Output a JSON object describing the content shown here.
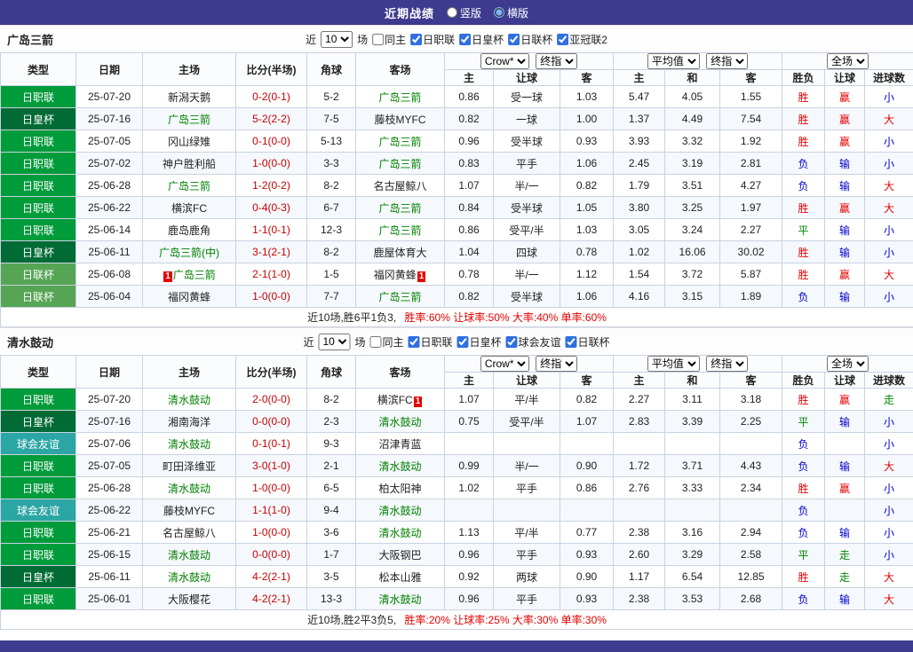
{
  "top_bar": {
    "title": "近期战绩",
    "radios": [
      {
        "label": "竖版",
        "selected": false
      },
      {
        "label": "横版",
        "selected": true
      }
    ]
  },
  "filter_labels": {
    "near": "近",
    "matches": "场"
  },
  "table_columns": {
    "type": "类型",
    "date": "日期",
    "home": "主场",
    "score": "比分(半场)",
    "corner": "角球",
    "away": "客场",
    "odds_home": "主",
    "odds_handicap": "让球",
    "odds_away": "客",
    "avg_home": "主",
    "avg_draw": "和",
    "avg_away": "客",
    "result": "胜负",
    "handicap_result": "让球",
    "goals": "进球数"
  },
  "odds_selects": {
    "bookmaker": "Crow*",
    "final_index": "终指",
    "average": "平均值",
    "full_time": "全场"
  },
  "colors": {
    "top_bar": "#3D3A8F",
    "score": "#C80000",
    "tracked_team": "#008000",
    "win": "#E60000",
    "lose": "#0000CC",
    "draw": "#008800",
    "summary_stats": "#E60000"
  },
  "sections": [
    {
      "team": "广岛三箭",
      "filter": {
        "count": "10",
        "same": {
          "label": "同主",
          "checked": false
        },
        "leagues": [
          {
            "label": "日职联",
            "checked": true
          },
          {
            "label": "日皇杯",
            "checked": true
          },
          {
            "label": "日联杯",
            "checked": true
          },
          {
            "label": "亚冠联2",
            "checked": true
          }
        ]
      },
      "rows": [
        {
          "league": "日职联",
          "league_color": "#009B3A",
          "date": "25-07-20",
          "home": "新潟天鹅",
          "home_tracked": false,
          "home_badge": "",
          "score": "0-2(0-1)",
          "corner": "5-2",
          "away": "广岛三箭",
          "away_tracked": true,
          "away_badge": "",
          "odds": [
            "0.86",
            "受一球",
            "1.03",
            "5.47",
            "4.05",
            "1.55"
          ],
          "results": [
            {
              "text": "胜",
              "kind": "win"
            },
            {
              "text": "赢",
              "kind": "win"
            },
            {
              "text": "小",
              "kind": "lose"
            }
          ]
        },
        {
          "league": "日皇杯",
          "league_color": "#006B35",
          "date": "25-07-16",
          "home": "广岛三箭",
          "home_tracked": true,
          "home_badge": "",
          "score": "5-2(2-2)",
          "corner": "7-5",
          "away": "藤枝MYFC",
          "away_tracked": false,
          "away_badge": "",
          "odds": [
            "0.82",
            "一球",
            "1.00",
            "1.37",
            "4.49",
            "7.54"
          ],
          "results": [
            {
              "text": "胜",
              "kind": "win"
            },
            {
              "text": "赢",
              "kind": "win"
            },
            {
              "text": "大",
              "kind": "win"
            }
          ]
        },
        {
          "league": "日职联",
          "league_color": "#009B3A",
          "date": "25-07-05",
          "home": "冈山绿雉",
          "home_tracked": false,
          "home_badge": "",
          "score": "0-1(0-0)",
          "corner": "5-13",
          "away": "广岛三箭",
          "away_tracked": true,
          "away_badge": "",
          "odds": [
            "0.96",
            "受半球",
            "0.93",
            "3.93",
            "3.32",
            "1.92"
          ],
          "results": [
            {
              "text": "胜",
              "kind": "win"
            },
            {
              "text": "赢",
              "kind": "win"
            },
            {
              "text": "小",
              "kind": "lose"
            }
          ]
        },
        {
          "league": "日职联",
          "league_color": "#009B3A",
          "date": "25-07-02",
          "home": "神户胜利船",
          "home_tracked": false,
          "home_badge": "",
          "score": "1-0(0-0)",
          "corner": "3-3",
          "away": "广岛三箭",
          "away_tracked": true,
          "away_badge": "",
          "odds": [
            "0.83",
            "平手",
            "1.06",
            "2.45",
            "3.19",
            "2.81"
          ],
          "results": [
            {
              "text": "负",
              "kind": "lose"
            },
            {
              "text": "输",
              "kind": "lose"
            },
            {
              "text": "小",
              "kind": "lose"
            }
          ]
        },
        {
          "league": "日职联",
          "league_color": "#009B3A",
          "date": "25-06-28",
          "home": "广岛三箭",
          "home_tracked": true,
          "home_badge": "",
          "score": "1-2(0-2)",
          "corner": "8-2",
          "away": "名古屋鲸八",
          "away_tracked": false,
          "away_badge": "",
          "odds": [
            "1.07",
            "半/一",
            "0.82",
            "1.79",
            "3.51",
            "4.27"
          ],
          "results": [
            {
              "text": "负",
              "kind": "lose"
            },
            {
              "text": "输",
              "kind": "lose"
            },
            {
              "text": "大",
              "kind": "win"
            }
          ]
        },
        {
          "league": "日职联",
          "league_color": "#009B3A",
          "date": "25-06-22",
          "home": "横滨FC",
          "home_tracked": false,
          "home_badge": "",
          "score": "0-4(0-3)",
          "corner": "6-7",
          "away": "广岛三箭",
          "away_tracked": true,
          "away_badge": "",
          "odds": [
            "0.84",
            "受半球",
            "1.05",
            "3.80",
            "3.25",
            "1.97"
          ],
          "results": [
            {
              "text": "胜",
              "kind": "win"
            },
            {
              "text": "赢",
              "kind": "win"
            },
            {
              "text": "大",
              "kind": "win"
            }
          ]
        },
        {
          "league": "日职联",
          "league_color": "#009B3A",
          "date": "25-06-14",
          "home": "鹿岛鹿角",
          "home_tracked": false,
          "home_badge": "",
          "score": "1-1(0-1)",
          "corner": "12-3",
          "away": "广岛三箭",
          "away_tracked": true,
          "away_badge": "",
          "odds": [
            "0.86",
            "受平/半",
            "1.03",
            "3.05",
            "3.24",
            "2.27"
          ],
          "results": [
            {
              "text": "平",
              "kind": "draw"
            },
            {
              "text": "输",
              "kind": "lose"
            },
            {
              "text": "小",
              "kind": "lose"
            }
          ]
        },
        {
          "league": "日皇杯",
          "league_color": "#006B35",
          "date": "25-06-11",
          "home": "广岛三箭(中)",
          "home_tracked": true,
          "home_badge": "",
          "score": "3-1(2-1)",
          "corner": "8-2",
          "away": "鹿屋体育大",
          "away_tracked": false,
          "away_badge": "",
          "odds": [
            "1.04",
            "四球",
            "0.78",
            "1.02",
            "16.06",
            "30.02"
          ],
          "results": [
            {
              "text": "胜",
              "kind": "win"
            },
            {
              "text": "输",
              "kind": "lose"
            },
            {
              "text": "小",
              "kind": "lose"
            }
          ]
        },
        {
          "league": "日联杯",
          "league_color": "#55A555",
          "date": "25-06-08",
          "home": "广岛三箭",
          "home_tracked": true,
          "home_badge": "1",
          "score": "2-1(1-0)",
          "corner": "1-5",
          "away": "福冈黄蜂",
          "away_tracked": false,
          "away_badge": "1",
          "odds": [
            "0.78",
            "半/一",
            "1.12",
            "1.54",
            "3.72",
            "5.87"
          ],
          "results": [
            {
              "text": "胜",
              "kind": "win"
            },
            {
              "text": "赢",
              "kind": "win"
            },
            {
              "text": "大",
              "kind": "win"
            }
          ]
        },
        {
          "league": "日联杯",
          "league_color": "#55A555",
          "date": "25-06-04",
          "home": "福冈黄蜂",
          "home_tracked": false,
          "home_badge": "",
          "score": "1-0(0-0)",
          "corner": "7-7",
          "away": "广岛三箭",
          "away_tracked": true,
          "away_badge": "",
          "odds": [
            "0.82",
            "受半球",
            "1.06",
            "4.16",
            "3.15",
            "1.89"
          ],
          "results": [
            {
              "text": "负",
              "kind": "lose"
            },
            {
              "text": "输",
              "kind": "lose"
            },
            {
              "text": "小",
              "kind": "lose"
            }
          ]
        }
      ],
      "summary": {
        "record": "近10场,胜6平1负3,",
        "stats": "胜率:60% 让球率:50% 大率:40% 单率:60%"
      }
    },
    {
      "team": "清水鼓动",
      "filter": {
        "count": "10",
        "same": {
          "label": "同主",
          "checked": false
        },
        "leagues": [
          {
            "label": "日职联",
            "checked": true
          },
          {
            "label": "日皇杯",
            "checked": true
          },
          {
            "label": "球会友谊",
            "checked": true
          },
          {
            "label": "日联杯",
            "checked": true
          }
        ]
      },
      "rows": [
        {
          "league": "日职联",
          "league_color": "#009B3A",
          "date": "25-07-20",
          "home": "清水鼓动",
          "home_tracked": true,
          "home_badge": "",
          "score": "2-0(0-0)",
          "corner": "8-2",
          "away": "横滨FC",
          "away_tracked": false,
          "away_badge": "1",
          "odds": [
            "1.07",
            "平/半",
            "0.82",
            "2.27",
            "3.11",
            "3.18"
          ],
          "results": [
            {
              "text": "胜",
              "kind": "win"
            },
            {
              "text": "赢",
              "kind": "win"
            },
            {
              "text": "走",
              "kind": "draw"
            }
          ]
        },
        {
          "league": "日皇杯",
          "league_color": "#006B35",
          "date": "25-07-16",
          "home": "湘南海洋",
          "home_tracked": false,
          "home_badge": "",
          "score": "0-0(0-0)",
          "corner": "2-3",
          "away": "清水鼓动",
          "away_tracked": true,
          "away_badge": "",
          "odds": [
            "0.75",
            "受平/半",
            "1.07",
            "2.83",
            "3.39",
            "2.25"
          ],
          "results": [
            {
              "text": "平",
              "kind": "draw"
            },
            {
              "text": "输",
              "kind": "lose"
            },
            {
              "text": "小",
              "kind": "lose"
            }
          ]
        },
        {
          "league": "球会友谊",
          "league_color": "#2CA6A4",
          "date": "25-07-06",
          "home": "清水鼓动",
          "home_tracked": true,
          "home_badge": "",
          "score": "0-1(0-1)",
          "corner": "9-3",
          "away": "沼津青蓝",
          "away_tracked": false,
          "away_badge": "",
          "odds": [
            "",
            "",
            "",
            "",
            "",
            ""
          ],
          "results": [
            {
              "text": "负",
              "kind": "lose"
            },
            {
              "text": "",
              "kind": ""
            },
            {
              "text": "小",
              "kind": "lose"
            }
          ]
        },
        {
          "league": "日职联",
          "league_color": "#009B3A",
          "date": "25-07-05",
          "home": "町田泽维亚",
          "home_tracked": false,
          "home_badge": "",
          "score": "3-0(1-0)",
          "corner": "2-1",
          "away": "清水鼓动",
          "away_tracked": true,
          "away_badge": "",
          "odds": [
            "0.99",
            "半/一",
            "0.90",
            "1.72",
            "3.71",
            "4.43"
          ],
          "results": [
            {
              "text": "负",
              "kind": "lose"
            },
            {
              "text": "输",
              "kind": "lose"
            },
            {
              "text": "大",
              "kind": "win"
            }
          ]
        },
        {
          "league": "日职联",
          "league_color": "#009B3A",
          "date": "25-06-28",
          "home": "清水鼓动",
          "home_tracked": true,
          "home_badge": "",
          "score": "1-0(0-0)",
          "corner": "6-5",
          "away": "柏太阳神",
          "away_tracked": false,
          "away_badge": "",
          "odds": [
            "1.02",
            "平手",
            "0.86",
            "2.76",
            "3.33",
            "2.34"
          ],
          "results": [
            {
              "text": "胜",
              "kind": "win"
            },
            {
              "text": "赢",
              "kind": "win"
            },
            {
              "text": "小",
              "kind": "lose"
            }
          ]
        },
        {
          "league": "球会友谊",
          "league_color": "#2CA6A4",
          "date": "25-06-22",
          "home": "藤枝MYFC",
          "home_tracked": false,
          "home_badge": "",
          "score": "1-1(1-0)",
          "corner": "9-4",
          "away": "清水鼓动",
          "away_tracked": true,
          "away_badge": "",
          "odds": [
            "",
            "",
            "",
            "",
            "",
            ""
          ],
          "results": [
            {
              "text": "负",
              "kind": "lose"
            },
            {
              "text": "",
              "kind": ""
            },
            {
              "text": "小",
              "kind": "lose"
            }
          ]
        },
        {
          "league": "日职联",
          "league_color": "#009B3A",
          "date": "25-06-21",
          "home": "名古屋鲸八",
          "home_tracked": false,
          "home_badge": "",
          "score": "1-0(0-0)",
          "corner": "3-6",
          "away": "清水鼓动",
          "away_tracked": true,
          "away_badge": "",
          "odds": [
            "1.13",
            "平/半",
            "0.77",
            "2.38",
            "3.16",
            "2.94"
          ],
          "results": [
            {
              "text": "负",
              "kind": "lose"
            },
            {
              "text": "输",
              "kind": "lose"
            },
            {
              "text": "小",
              "kind": "lose"
            }
          ]
        },
        {
          "league": "日职联",
          "league_color": "#009B3A",
          "date": "25-06-15",
          "home": "清水鼓动",
          "home_tracked": true,
          "home_badge": "",
          "score": "0-0(0-0)",
          "corner": "1-7",
          "away": "大阪钢巴",
          "away_tracked": false,
          "away_badge": "",
          "odds": [
            "0.96",
            "平手",
            "0.93",
            "2.60",
            "3.29",
            "2.58"
          ],
          "results": [
            {
              "text": "平",
              "kind": "draw"
            },
            {
              "text": "走",
              "kind": "draw"
            },
            {
              "text": "小",
              "kind": "lose"
            }
          ]
        },
        {
          "league": "日皇杯",
          "league_color": "#006B35",
          "date": "25-06-11",
          "home": "清水鼓动",
          "home_tracked": true,
          "home_badge": "",
          "score": "4-2(2-1)",
          "corner": "3-5",
          "away": "松本山雅",
          "away_tracked": false,
          "away_badge": "",
          "odds": [
            "0.92",
            "两球",
            "0.90",
            "1.17",
            "6.54",
            "12.85"
          ],
          "results": [
            {
              "text": "胜",
              "kind": "win"
            },
            {
              "text": "走",
              "kind": "draw"
            },
            {
              "text": "大",
              "kind": "win"
            }
          ]
        },
        {
          "league": "日职联",
          "league_color": "#009B3A",
          "date": "25-06-01",
          "home": "大阪樱花",
          "home_tracked": false,
          "home_badge": "",
          "score": "4-2(2-1)",
          "corner": "13-3",
          "away": "清水鼓动",
          "away_tracked": true,
          "away_badge": "",
          "odds": [
            "0.96",
            "平手",
            "0.93",
            "2.38",
            "3.53",
            "2.68"
          ],
          "results": [
            {
              "text": "负",
              "kind": "lose"
            },
            {
              "text": "输",
              "kind": "lose"
            },
            {
              "text": "大",
              "kind": "win"
            }
          ]
        }
      ],
      "summary": {
        "record": "近10场,胜2平3负5,",
        "stats": "胜率:20% 让球率:25% 大率:30% 单率:30%"
      }
    }
  ]
}
